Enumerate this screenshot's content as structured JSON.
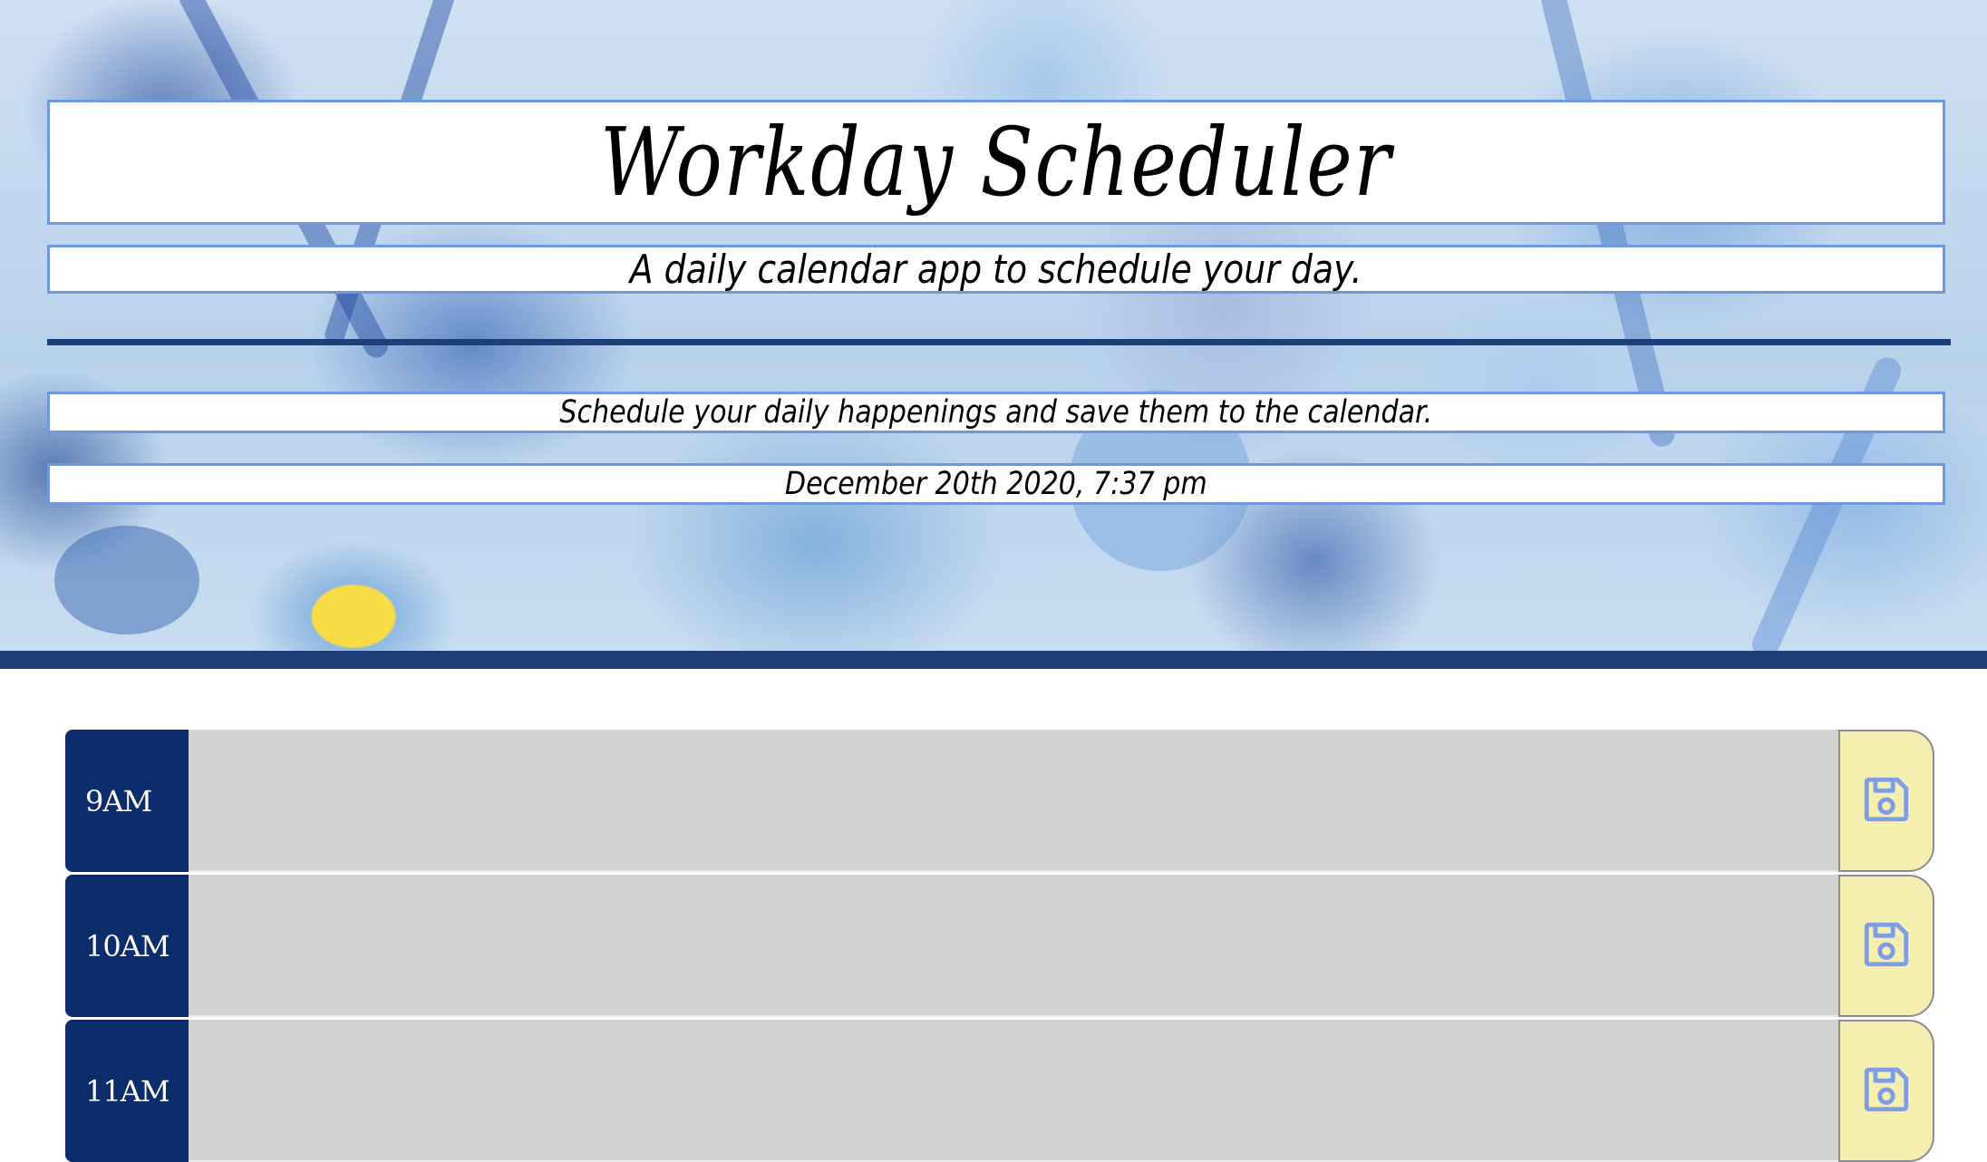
{
  "header": {
    "title": "Workday Scheduler",
    "subtitle": "A daily calendar app to schedule your day.",
    "description": "Schedule your daily happenings and save them to the calendar.",
    "current_date": "December 20th 2020, 7:37 pm"
  },
  "colors": {
    "accent_border": "#6f98e0",
    "navy": "#0c2d6b",
    "rule": "#1b3f76",
    "task_bg": "#d3d3d3",
    "save_bg": "#f6eeae",
    "save_icon": "#7e9de4"
  },
  "schedule": {
    "rows": [
      {
        "hour": "9AM",
        "task": "",
        "save_icon": "floppy-disk-icon"
      },
      {
        "hour": "10AM",
        "task": "",
        "save_icon": "floppy-disk-icon"
      },
      {
        "hour": "11AM",
        "task": "",
        "save_icon": "floppy-disk-icon"
      }
    ]
  }
}
